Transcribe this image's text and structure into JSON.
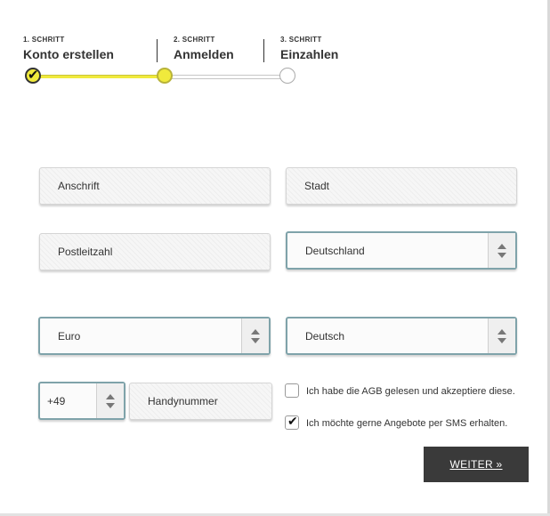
{
  "stepper": {
    "steps": [
      {
        "number_label": "1. SCHRITT",
        "title": "Konto erstellen",
        "state": "done"
      },
      {
        "number_label": "2. SCHRITT",
        "title": "Anmelden",
        "state": "active"
      },
      {
        "number_label": "3. SCHRITT",
        "title": "Einzahlen",
        "state": "todo"
      }
    ],
    "check_glyph": "✔",
    "accent_color": "#f0ea3c"
  },
  "form": {
    "address": "Anschrift",
    "city": "Stadt",
    "postcode": "Postleitzahl",
    "country": "Deutschland",
    "currency": "Euro",
    "language": "Deutsch",
    "phone_prefix": "+49",
    "phone_number": "Handynummer"
  },
  "consents": {
    "terms_label": "Ich habe die AGB gelesen und akzeptiere diese.",
    "terms_checked": false,
    "sms_label": "Ich möchte gerne Angebote per SMS erhalten.",
    "sms_checked": true,
    "check_glyph": "✔"
  },
  "actions": {
    "next_label": "WEITER »"
  }
}
